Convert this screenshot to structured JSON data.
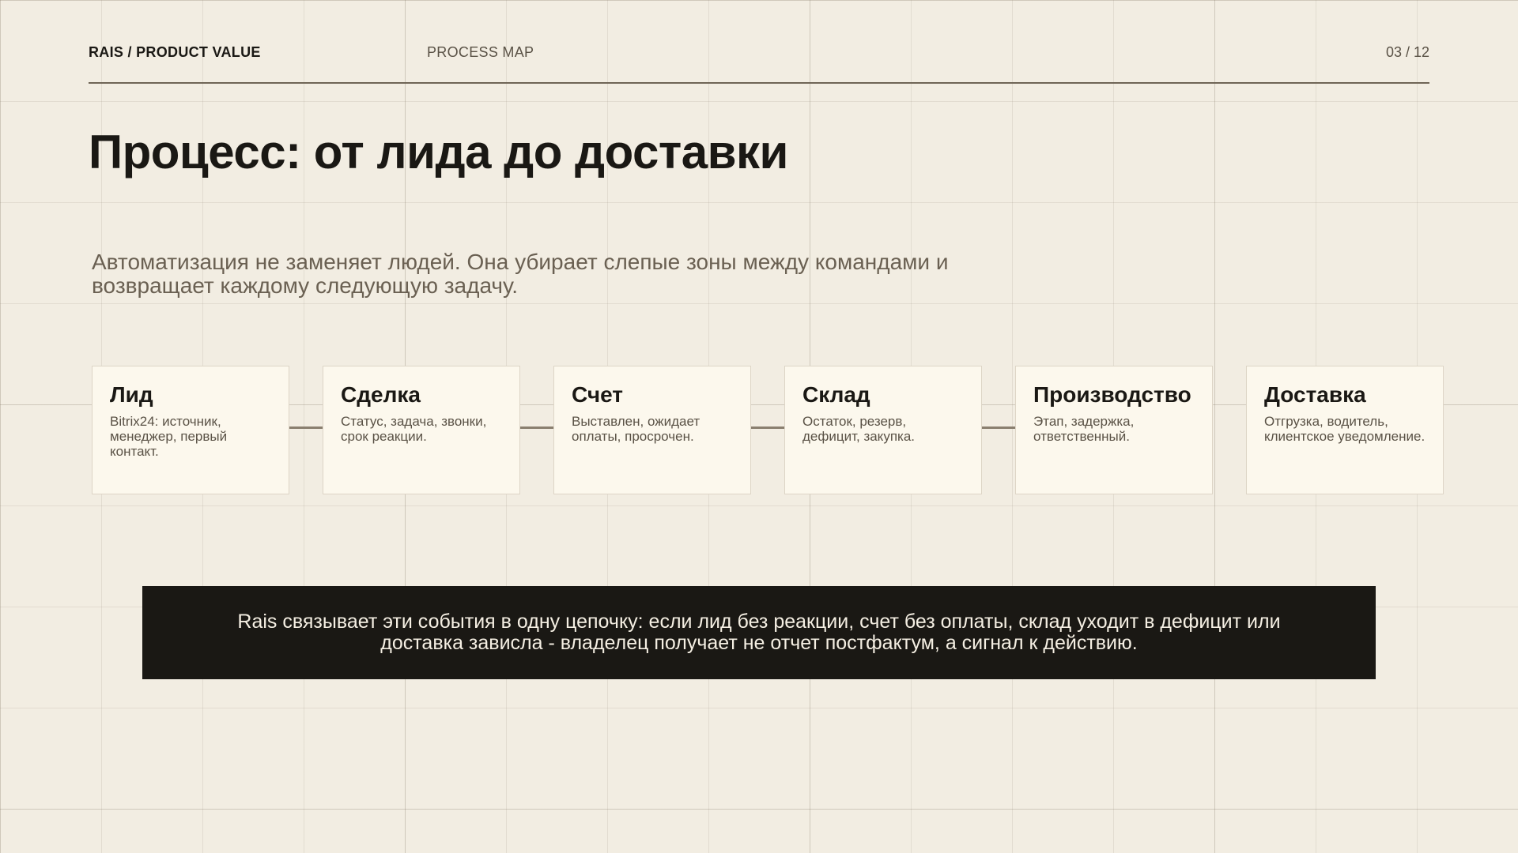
{
  "header": {
    "brand": "RAIS / PRODUCT VALUE",
    "section": "PROCESS MAP",
    "page": "03 / 12"
  },
  "title": "Процесс: от лида до доставки",
  "subtitle": "Автоматизация не заменяет людей. Она убирает слепые зоны между командами и возвращает каждому следующую задачу.",
  "steps": [
    {
      "title": "Лид",
      "desc": "Bitrix24: источник, менеджер, первый контакт."
    },
    {
      "title": "Сделка",
      "desc": "Статус, задача, звонки, срок реакции."
    },
    {
      "title": "Счет",
      "desc": "Выставлен, ожидает оплаты, просрочен."
    },
    {
      "title": "Склад",
      "desc": "Остаток, резерв, дефицит, закупка."
    },
    {
      "title": "Производство",
      "desc": "Этап, задержка, ответственный."
    },
    {
      "title": "Доставка",
      "desc": "Отгрузка, водитель, клиентское уведомление."
    }
  ],
  "banner": "Rais связывает эти события в одну цепочку: если лид без реакции, счет без оплаты, склад уходит в дефицит или доставка зависла - владелец получает не отчет постфактум, а сигнал к действию.",
  "colors": {
    "background": "#f2ede2",
    "card": "#fcf8ed",
    "banner": "#1a1814",
    "accent_line": "#6f6556"
  }
}
